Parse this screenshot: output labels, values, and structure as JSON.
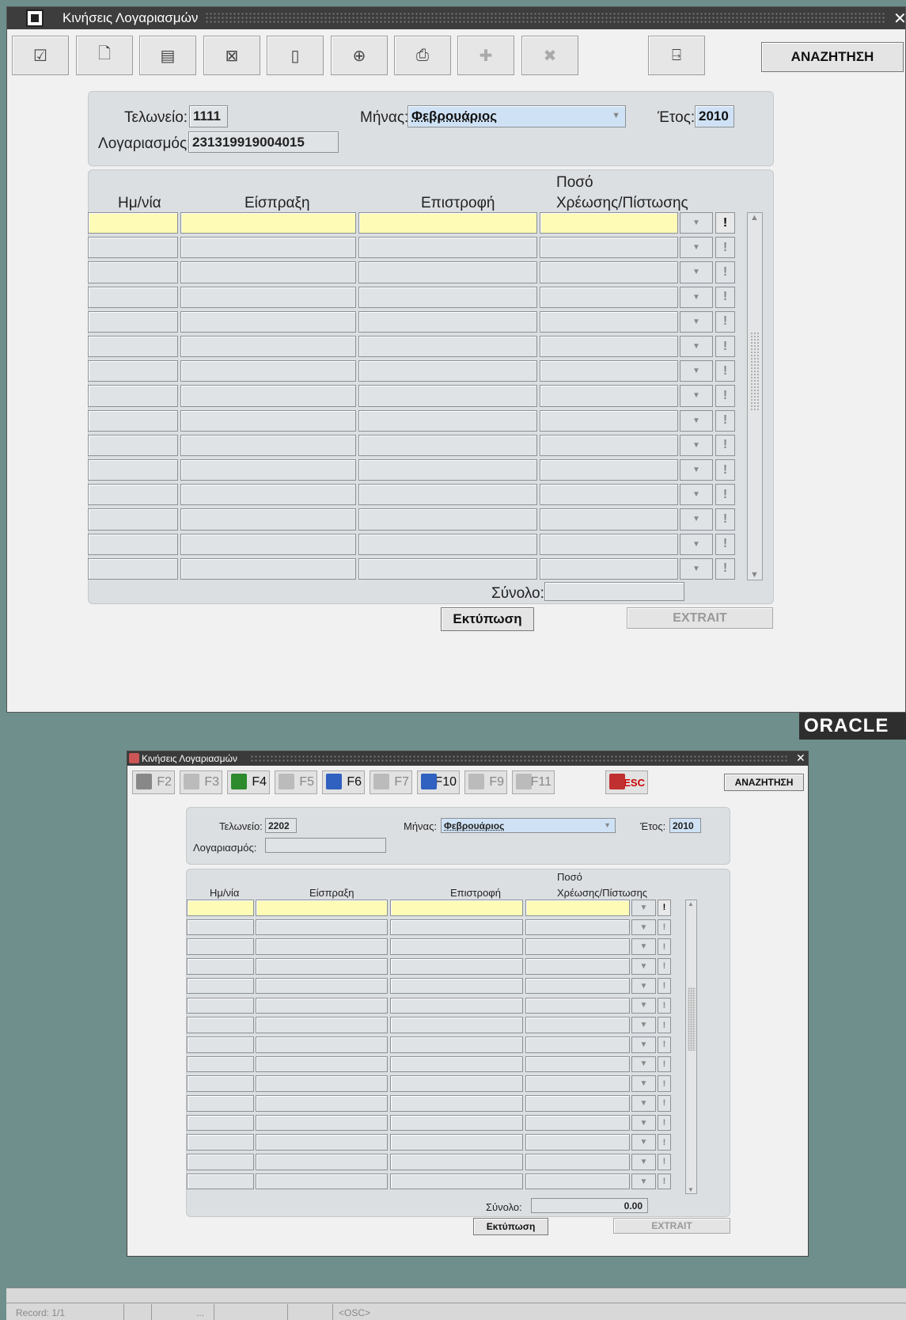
{
  "window1": {
    "title": "Κινήσεις Λογαριασμών",
    "search_button": "ΑΝΑΖΗΤΗΣΗ",
    "toolbar_icons": [
      "save-icon",
      "query-icon",
      "document-icon",
      "delete-icon",
      "new-icon",
      "zoom-icon",
      "print-icon",
      "insert-row-icon",
      "delete-row-icon",
      "exit-icon"
    ],
    "form": {
      "customs_label": "Τελωνείο:",
      "customs_value": "1111",
      "month_label": "Μήνας:",
      "month_value": "Φεβρουάριος",
      "year_label": "Έτος:",
      "year_value": "2010",
      "account_label": "Λογαριασμός:",
      "account_value": "231319919004015"
    },
    "table": {
      "col_date": "Ημ/νία",
      "col_receipt": "Είσπραξη",
      "col_refund": "Επιστροφή",
      "col_amount_line1": "Ποσό",
      "col_amount_line2": "Χρέωσης/Πίστωσης",
      "row_count": 15,
      "total_label": "Σύνολο:",
      "total_value": ""
    },
    "print_button": "Εκτύπωση",
    "extrait_button": "EXTRAIT"
  },
  "oracle_logo": "ORACLE",
  "window2": {
    "title": "Κινήσεις Λογαριασμών",
    "fkeys": [
      "F2",
      "F3",
      "F4",
      "F5",
      "F6",
      "F7",
      "F10",
      "F9",
      "F11",
      "ESC"
    ],
    "search_button": "ΑΝΑΖΗΤΗΣΗ",
    "form": {
      "customs_label": "Τελωνείο:",
      "customs_value": "2202",
      "month_label": "Μήνας:",
      "month_value": "Φεβρουάριος",
      "year_label": "Έτος:",
      "year_value": "2010",
      "account_label": "Λογαριασμός:",
      "account_value": ""
    },
    "table": {
      "col_date": "Ημ/νία",
      "col_receipt": "Είσπραξη",
      "col_refund": "Επιστροφή",
      "col_amount_line1": "Ποσό",
      "col_amount_line2": "Χρέωσης/Πίστωσης",
      "row_count": 15,
      "total_label": "Σύνολο:",
      "total_value": "0.00"
    },
    "print_button": "Εκτύπωση",
    "extrait_button": "EXTRAIT"
  },
  "statusbar": {
    "record": "Record: 1/1",
    "dots": "...",
    "osc": "<OSC>"
  }
}
